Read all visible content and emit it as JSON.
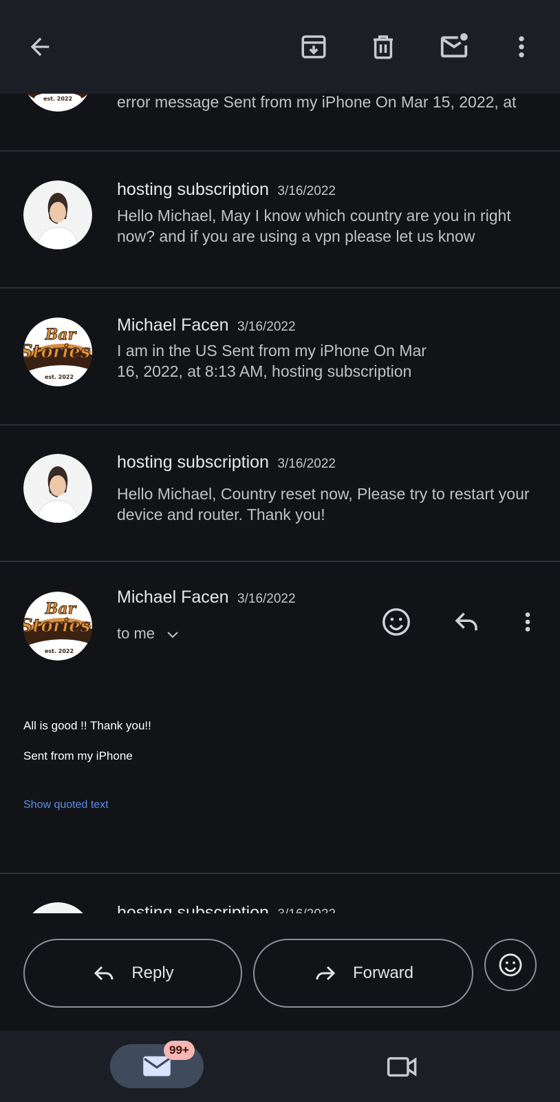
{
  "topbar": {
    "back_icon": "arrow-left-icon",
    "archive_icon": "archive-icon",
    "delete_icon": "trash-icon",
    "mark_unread_icon": "mail-unread-icon",
    "more_icon": "more-vert-icon"
  },
  "thread": {
    "messages": [
      {
        "sender": "",
        "date": "",
        "snippet": "error message Sent from my iPhone On Mar 15, 2022, at",
        "avatar": "bar-stories-logo"
      },
      {
        "sender": "hosting subscription",
        "date": "3/16/2022",
        "snippet": "Hello Michael, May I know which country are you in right now? and if you are using a vpn please let us know",
        "avatar": "support-agent-photo"
      },
      {
        "sender": "Michael Facen",
        "date": "3/16/2022",
        "snippet": "I am in the US Sent from my iPhone On Mar 16, 2022, at 8:13 AM, hosting subscription",
        "avatar": "bar-stories-logo"
      },
      {
        "sender": "hosting subscription",
        "date": "3/16/2022",
        "snippet": "Hello Michael, Country reset now, Please try to restart your device and router. Thank you!",
        "avatar": "support-agent-photo"
      }
    ],
    "expanded": {
      "sender": "Michael Facen",
      "date": "3/16/2022",
      "to_me": "to me",
      "body_line1": "All is good !! Thank you!!",
      "body_line2": "Sent from my iPhone",
      "show_quoted": "Show quoted text",
      "avatar": "bar-stories-logo"
    },
    "next_partial": {
      "sender": "hosting subscription",
      "date": "3/16/2022"
    }
  },
  "actions": {
    "reply_label": "Reply",
    "forward_label": "Forward"
  },
  "bottomnav": {
    "mail_badge": "99+"
  },
  "colors": {
    "background": "#111317",
    "bar": "#1b1e25",
    "link": "#5c8fe8",
    "badge": "#f4b7b3"
  }
}
